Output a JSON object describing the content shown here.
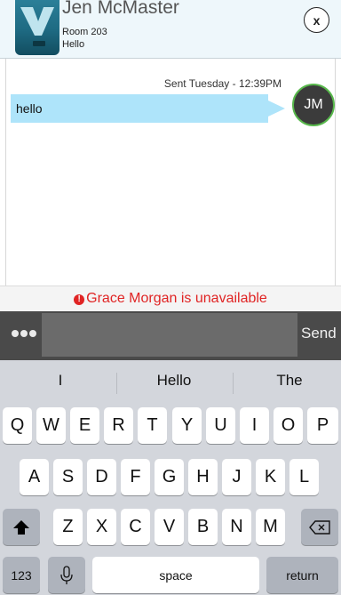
{
  "header": {
    "contact_name": "Jen McMaster",
    "room": "Room 203",
    "status": "Hello",
    "close_label": "x"
  },
  "chat": {
    "sent_time": "Sent Tuesday - 12:39PM",
    "message_text": "hello",
    "avatar_initials": "JM"
  },
  "banner": {
    "text": "Grace Morgan is unavailable",
    "icon": "alert-icon"
  },
  "composer": {
    "value": "",
    "send_label": "Send"
  },
  "keyboard": {
    "suggestions": [
      "I",
      "Hello",
      "The"
    ],
    "row1": [
      "Q",
      "W",
      "E",
      "R",
      "T",
      "Y",
      "U",
      "I",
      "O",
      "P"
    ],
    "row2": [
      "A",
      "S",
      "D",
      "F",
      "G",
      "H",
      "J",
      "K",
      "L"
    ],
    "row3": [
      "Z",
      "X",
      "C",
      "V",
      "B",
      "N",
      "M"
    ],
    "numbers_label": "123",
    "space_label": "space",
    "return_label": "return"
  }
}
